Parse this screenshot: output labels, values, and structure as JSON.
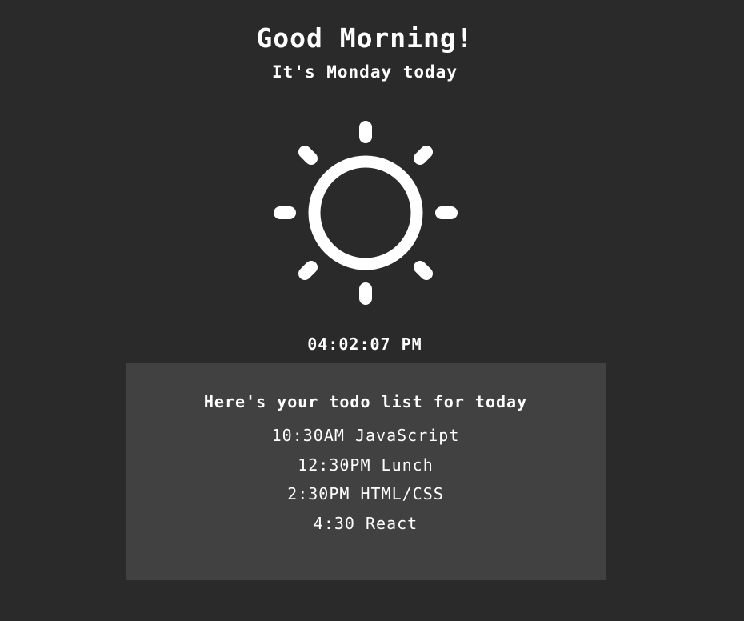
{
  "header": {
    "greeting": "Good Morning!",
    "subtitle": "It's Monday today"
  },
  "weather": {
    "icon": "sun-icon"
  },
  "clock": {
    "time": "04:02:07 PM"
  },
  "todo": {
    "heading": "Here's your todo list for today",
    "items": [
      {
        "text": "10:30AM JavaScript"
      },
      {
        "text": "12:30PM Lunch"
      },
      {
        "text": "2:30PM HTML/CSS"
      },
      {
        "text": "4:30 React"
      }
    ]
  },
  "colors": {
    "background": "#2a2a2a",
    "panel": "#414141",
    "text": "#ffffff"
  }
}
